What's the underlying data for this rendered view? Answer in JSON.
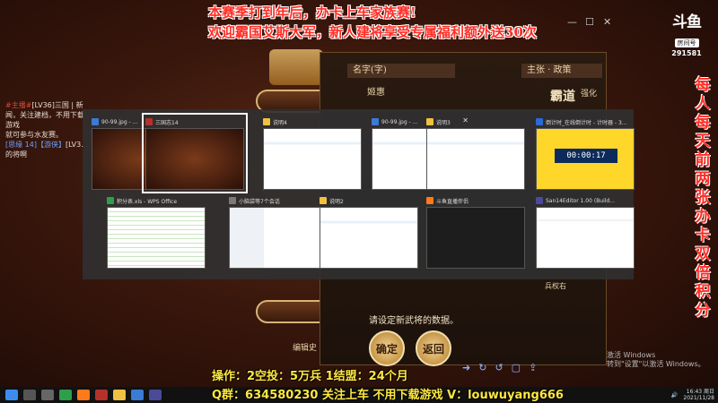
{
  "banner": {
    "line1": "本赛季打到年后，办卡上车家族赛!",
    "line2": "欢迎霸国艾斯大军，新人建将享受专属福利额外送30次"
  },
  "right_banner": "每人每天前两张办卡双倍积分",
  "logo": {
    "mark": "斗鱼",
    "tag": "房间号",
    "room": "291581"
  },
  "chat": [
    {
      "prefix": "#主播#",
      "text": "[LV36]三国 | 新闻，关注建档，不用下载游戏"
    },
    {
      "prefix": "",
      "text": "就可参与水友赛。"
    },
    {
      "prefix": "[思缘 14]【游侠】",
      "text": "[LV3..."
    },
    {
      "prefix": "",
      "text": "的将啊"
    }
  ],
  "dialog": {
    "header_left": "名字(字)",
    "header_right": "主张 · 政策",
    "name": "姬惠",
    "side_big": "霸道",
    "side_small": "强化",
    "tiny": "兵权右",
    "prompt": "请设定新武将的数据。",
    "confirm": "确定",
    "back": "返回",
    "bottom_label": "编辑史"
  },
  "switcher": {
    "row1": [
      {
        "title": "90-99.jpg - ...",
        "body": "game",
        "icon": "#3a7bd5"
      },
      {
        "title": "三国志14",
        "body": "game",
        "icon": "#b5312a",
        "selected": true
      },
      {
        "title": "说明4",
        "body": "explorer",
        "icon": "#f0c040"
      },
      {
        "title": "90-99.jpg - ...",
        "body": "explorer",
        "icon": "#3a7bd5",
        "close": "✕"
      },
      {
        "title": "说明3",
        "body": "explorer",
        "icon": "#f0c040"
      },
      {
        "title": "倒计时_在线倒计时 - 计时器 - 3...",
        "body": "timer",
        "icon": "#2a6ad6",
        "timer": "00:00:17"
      }
    ],
    "row2": [
      {
        "title": "积分表.xls - WPS Office",
        "body": "sheet",
        "icon": "#2e9e4a"
      },
      {
        "title": "小脑袋等7个会话",
        "body": "chat",
        "icon": "#7a7a7a"
      },
      {
        "title": "说明2",
        "body": "explorer",
        "icon": "#f0c040"
      },
      {
        "title": "斗鱼直播伴侣",
        "body": "dark",
        "icon": "#ff7a1a"
      },
      {
        "title": "San14Editor 1.00 (Build...",
        "body": "editor",
        "icon": "#4a4a9a"
      }
    ]
  },
  "info": {
    "line1": "操作：2空投：5万兵      1结盟：24个月",
    "line2": "Q群：634580230 关注上车 不用下载游戏 V：louwuyang666"
  },
  "watermark": {
    "line1": "激活 Windows",
    "line2": "转到\"设置\"以激活 Windows。"
  },
  "tray": {
    "time": "16:43 周日",
    "date": "2021/11/28"
  },
  "colors": {
    "banner_red": "#ff2d24",
    "info_yellow": "#ffe840"
  }
}
